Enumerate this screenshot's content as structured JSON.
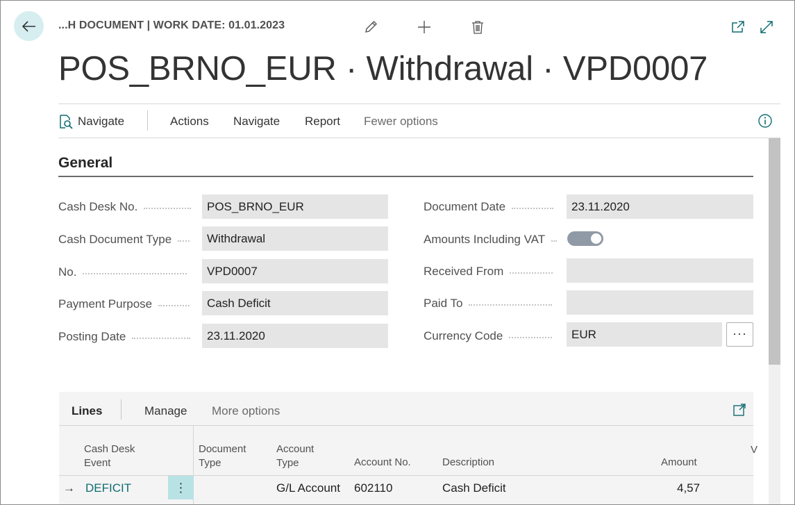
{
  "header": {
    "caption": "...H DOCUMENT | WORK DATE: 01.01.2023",
    "title": "POS_BRNO_EUR · Withdrawal · VPD0007",
    "icons": [
      "back-arrow-icon",
      "pencil-icon",
      "plus-icon",
      "trash-icon",
      "open-new-window-icon",
      "expand-icon"
    ]
  },
  "command_bar": {
    "primary": "Navigate",
    "items": [
      "Actions",
      "Navigate",
      "Report"
    ],
    "fewer_options": "Fewer options",
    "info_icon": "info-icon"
  },
  "general": {
    "title": "General",
    "left_fields": [
      {
        "label": "Cash Desk No.",
        "value": "POS_BRNO_EUR"
      },
      {
        "label": "Cash Document Type",
        "value": "Withdrawal"
      },
      {
        "label": "No.",
        "value": "VPD0007"
      },
      {
        "label": "Payment Purpose",
        "value": "Cash Deficit"
      },
      {
        "label": "Posting Date",
        "value": "23.11.2020"
      }
    ],
    "right_fields": [
      {
        "label": "Document Date",
        "value": "23.11.2020"
      },
      {
        "label": "Amounts Including VAT",
        "value": ""
      },
      {
        "label": "Received From",
        "value": ""
      },
      {
        "label": "Paid To",
        "value": ""
      },
      {
        "label": "Currency Code",
        "value": "EUR"
      }
    ],
    "amounts_including_vat_on": true,
    "currency_lookup_label": "···"
  },
  "lines": {
    "tabs": [
      "Lines",
      "Manage",
      "More options"
    ],
    "columns": {
      "cash_desk_event_1": "Cash Desk",
      "cash_desk_event_2": "Event",
      "document_type_1": "Document",
      "document_type_2": "Type",
      "account_type_1": "Account",
      "account_type_2": "Type",
      "account_no": "Account No.",
      "description": "Description",
      "amount": "Amount",
      "clipped": "V"
    },
    "rows": [
      {
        "arrow": "→",
        "cash_desk_event": "DEFICIT",
        "menu": "⋮",
        "document_type": "",
        "account_type": "G/L Account",
        "account_no": "602110",
        "description": "Cash Deficit",
        "amount": "4,57"
      }
    ]
  },
  "colors": {
    "accent": "#0f6c72",
    "back_button_bg": "#d6eef0",
    "field_bg": "#e5e5e5",
    "selected_cell_bg": "#b9e2e5"
  }
}
